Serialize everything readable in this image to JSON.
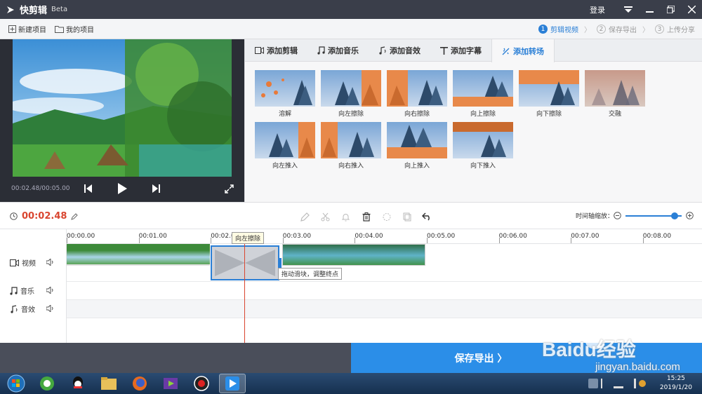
{
  "app": {
    "name": "快剪辑",
    "badge": "Beta",
    "login": "登录"
  },
  "toolbar": {
    "new_project": "新建项目",
    "my_projects": "我的项目",
    "steps": [
      {
        "num": "1",
        "label": "剪辑视频",
        "active": true
      },
      {
        "num": "2",
        "label": "保存导出",
        "active": false
      },
      {
        "num": "3",
        "label": "上传分享",
        "active": false
      }
    ]
  },
  "preview": {
    "time": "00:02.48/00:05.00"
  },
  "tabs": [
    {
      "label": "添加剪辑",
      "icon": "video-icon"
    },
    {
      "label": "添加音乐",
      "icon": "music-icon"
    },
    {
      "label": "添加音效",
      "icon": "sound-effect-icon"
    },
    {
      "label": "添加字幕",
      "icon": "text-icon"
    },
    {
      "label": "添加转场",
      "icon": "transition-icon",
      "active": true
    }
  ],
  "transitions": [
    {
      "label": "溶解"
    },
    {
      "label": "向左擦除"
    },
    {
      "label": "向右擦除"
    },
    {
      "label": "向上擦除"
    },
    {
      "label": "向下擦除"
    },
    {
      "label": "交融"
    },
    {
      "label": "向左推入"
    },
    {
      "label": "向右推入"
    },
    {
      "label": "向上推入"
    },
    {
      "label": "向下推入"
    }
  ],
  "timeline": {
    "current_time": "00:02.48",
    "zoom_label": "时间轴缩放：",
    "zoom_level": 0.88,
    "ticks": [
      "00:00.00",
      "00:01.00",
      "00:02.00",
      "00:03.00",
      "00:04.00",
      "00:05.00",
      "00:06.00",
      "00:07.00",
      "00:08.00"
    ],
    "tracks": [
      {
        "label": "视频"
      },
      {
        "label": "音乐"
      },
      {
        "label": "音效"
      }
    ],
    "transition_tooltip": "向左擦除",
    "drag_tooltip": "拖动滑块，调整终点"
  },
  "export": {
    "label": "保存导出 〉"
  },
  "watermark": {
    "brand": "Baidu经验",
    "url": "jingyan.baidu.com"
  },
  "taskbar": {
    "time": "15:25",
    "date": "2019/1/20"
  },
  "colors": {
    "accent": "#2a7fd6",
    "playhead": "#d9452f",
    "titlebar": "#3a3e4a",
    "export": "#2b8ee8"
  }
}
